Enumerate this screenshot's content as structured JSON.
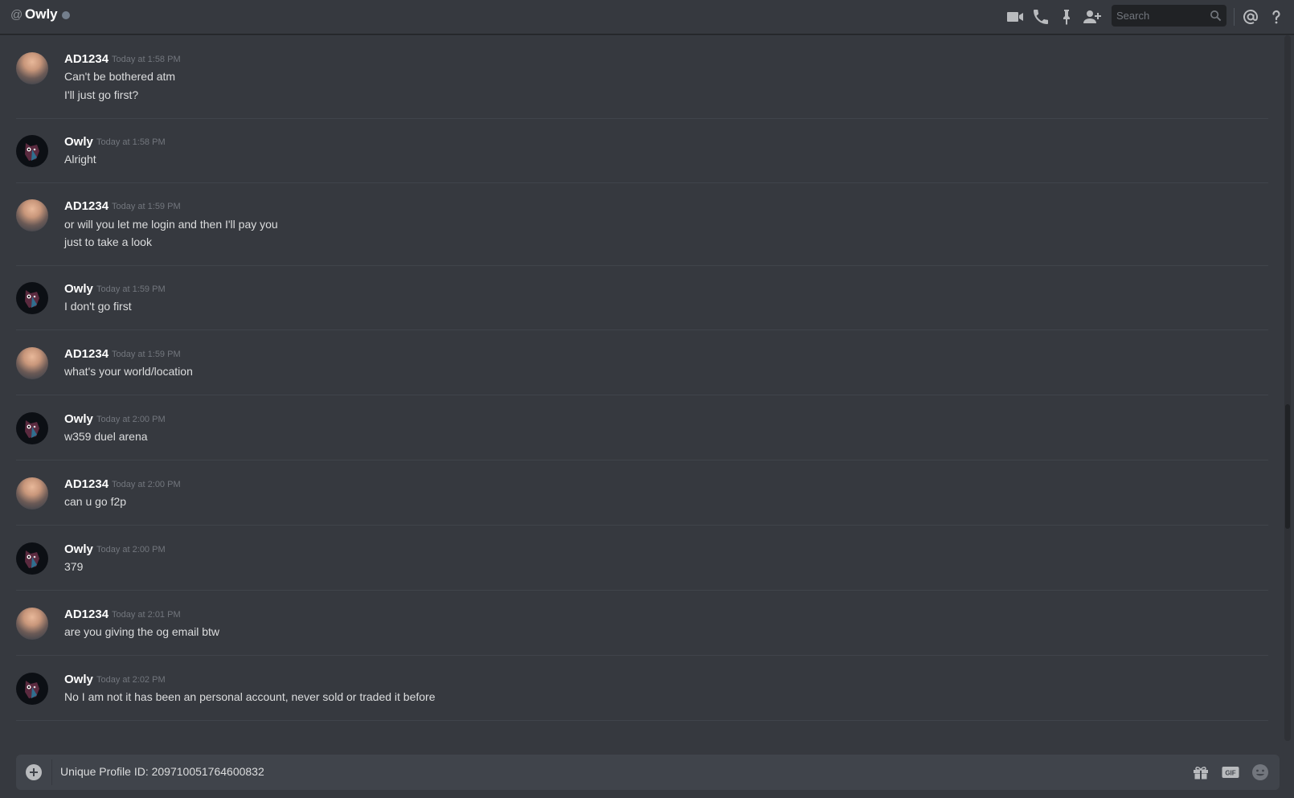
{
  "header": {
    "at_symbol": "@",
    "channel_name": "Owly",
    "search_placeholder": "Search",
    "icons": [
      "video-call-icon",
      "voice-call-icon",
      "pin-icon",
      "add-friend-icon",
      "search-icon",
      "mention-icon",
      "help-icon"
    ]
  },
  "messages": [
    {
      "author": "AD1234",
      "time": "Today at 1:58 PM",
      "lines": [
        "Can't be bothered atm",
        "I'll just go first?"
      ]
    },
    {
      "author": "Owly",
      "time": "Today at 1:58 PM",
      "lines": [
        "Alright"
      ]
    },
    {
      "author": "AD1234",
      "time": "Today at 1:59 PM",
      "lines": [
        "or will you let me login and then I'll pay you",
        "just to take a look"
      ]
    },
    {
      "author": "Owly",
      "time": "Today at 1:59 PM",
      "lines": [
        "I don't go first"
      ]
    },
    {
      "author": "AD1234",
      "time": "Today at 1:59 PM",
      "lines": [
        "what's your world/location"
      ]
    },
    {
      "author": "Owly",
      "time": "Today at 2:00 PM",
      "lines": [
        "w359 duel arena"
      ]
    },
    {
      "author": "AD1234",
      "time": "Today at 2:00 PM",
      "lines": [
        "can u go f2p"
      ]
    },
    {
      "author": "Owly",
      "time": "Today at 2:00 PM",
      "lines": [
        "379"
      ]
    },
    {
      "author": "AD1234",
      "time": "Today at 2:01 PM",
      "lines": [
        "are you giving the og email btw"
      ]
    },
    {
      "author": "Owly",
      "time": "Today at 2:02 PM",
      "lines": [
        "No I am not it has been an personal account, never sold or traded it before"
      ]
    }
  ],
  "composer": {
    "text": "Unique Profile ID: 209710051764600832",
    "icons": [
      "attach-plus-icon",
      "gift-icon",
      "gif-icon",
      "emoji-icon"
    ]
  },
  "colors": {
    "background": "#36393f",
    "header_border": "#202225",
    "username": "#ffffff",
    "timestamp": "#72767d",
    "message_text": "#dcddde",
    "composer_bg": "#40444b",
    "status_offline": "#747f8d"
  }
}
